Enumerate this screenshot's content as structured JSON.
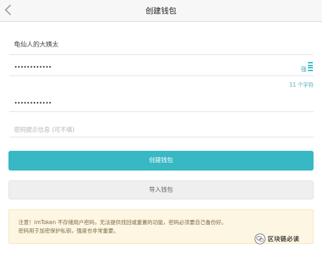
{
  "header": {
    "title": "创建钱包"
  },
  "form": {
    "wallet_name_value": "龟仙人的大姨太",
    "password_value": "••••••••••••",
    "password_strength_label": "强",
    "repeat_password_value": "••••••••••••",
    "char_count_text": "11 个字符",
    "hint_placeholder": "密码提示信息 (可不填)"
  },
  "buttons": {
    "create_label": "创建钱包",
    "import_label": "导入钱包"
  },
  "notice": {
    "text": "注意！imToken 不存储用户密码，无法提供找回或重置的功能，密码必须要自己备份好。密码用于加密保护私钥，强度也非常重要。"
  },
  "watermark": {
    "text": "区块链必读"
  },
  "colors": {
    "accent": "#37b8c4",
    "notice_bg": "#fdf6e2"
  },
  "icons": {
    "back": "chevron-left-icon",
    "strength": "strength-bars-icon",
    "watermark": "wechat-logo-icon"
  }
}
